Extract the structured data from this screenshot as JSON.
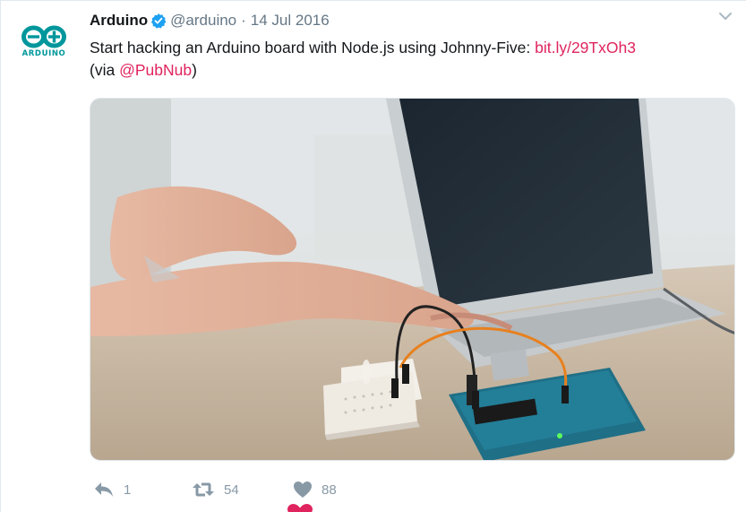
{
  "tweet": {
    "avatar": {
      "text": "ARDUINO",
      "icon": "arduino-logo-icon",
      "color": "#00979c"
    },
    "author": {
      "name": "Arduino",
      "verified_icon": "verified-badge-icon",
      "handle": "@arduino",
      "separator": "·",
      "date": "14 Jul 2016"
    },
    "caret_icon": "chevron-down-icon",
    "text": {
      "line1": "Start hacking an Arduino board with Node.js using Johnny-Five: ",
      "link": "bit.ly/29TxOh3",
      "via_open": "(via ",
      "mention": "@PubNub",
      "via_close": ")"
    },
    "media": {
      "description_icon": "photo-hands-laptop-arduino"
    },
    "actions": {
      "reply": {
        "icon": "reply-icon",
        "count": "1"
      },
      "retweet": {
        "icon": "retweet-icon",
        "count": "54"
      },
      "like": {
        "icon": "heart-icon",
        "count": "88"
      }
    },
    "colors": {
      "link": "#e0245e",
      "muted": "#8899a6",
      "verified": "#1da1f2"
    }
  }
}
